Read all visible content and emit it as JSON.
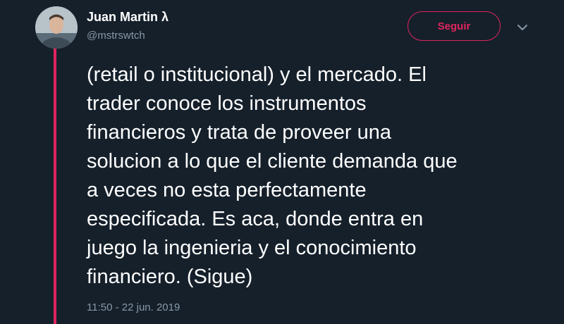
{
  "author": {
    "name": "Juan Martin λ",
    "handle": "@mstrswtch"
  },
  "follow_button": {
    "label": "Seguir"
  },
  "tweet": {
    "text": "(retail o institucional) y el mercado. El\ntrader conoce los instrumentos\nfinancieros y trata de proveer una\nsolucion a lo que el cliente demanda que\na veces no esta perfectamente\nespecificada. Es aca, donde entra en\njuego la ingenieria y el conocimiento\nfinanciero. (Sigue)",
    "timestamp": "11:50 - 22 jun. 2019"
  },
  "icons": {
    "menu": "chevron-down-icon",
    "avatar": "profile-photo"
  },
  "colors": {
    "background": "#15202b",
    "accent": "#e0245e",
    "text_primary": "#ffffff",
    "text_secondary": "#8899a6"
  }
}
